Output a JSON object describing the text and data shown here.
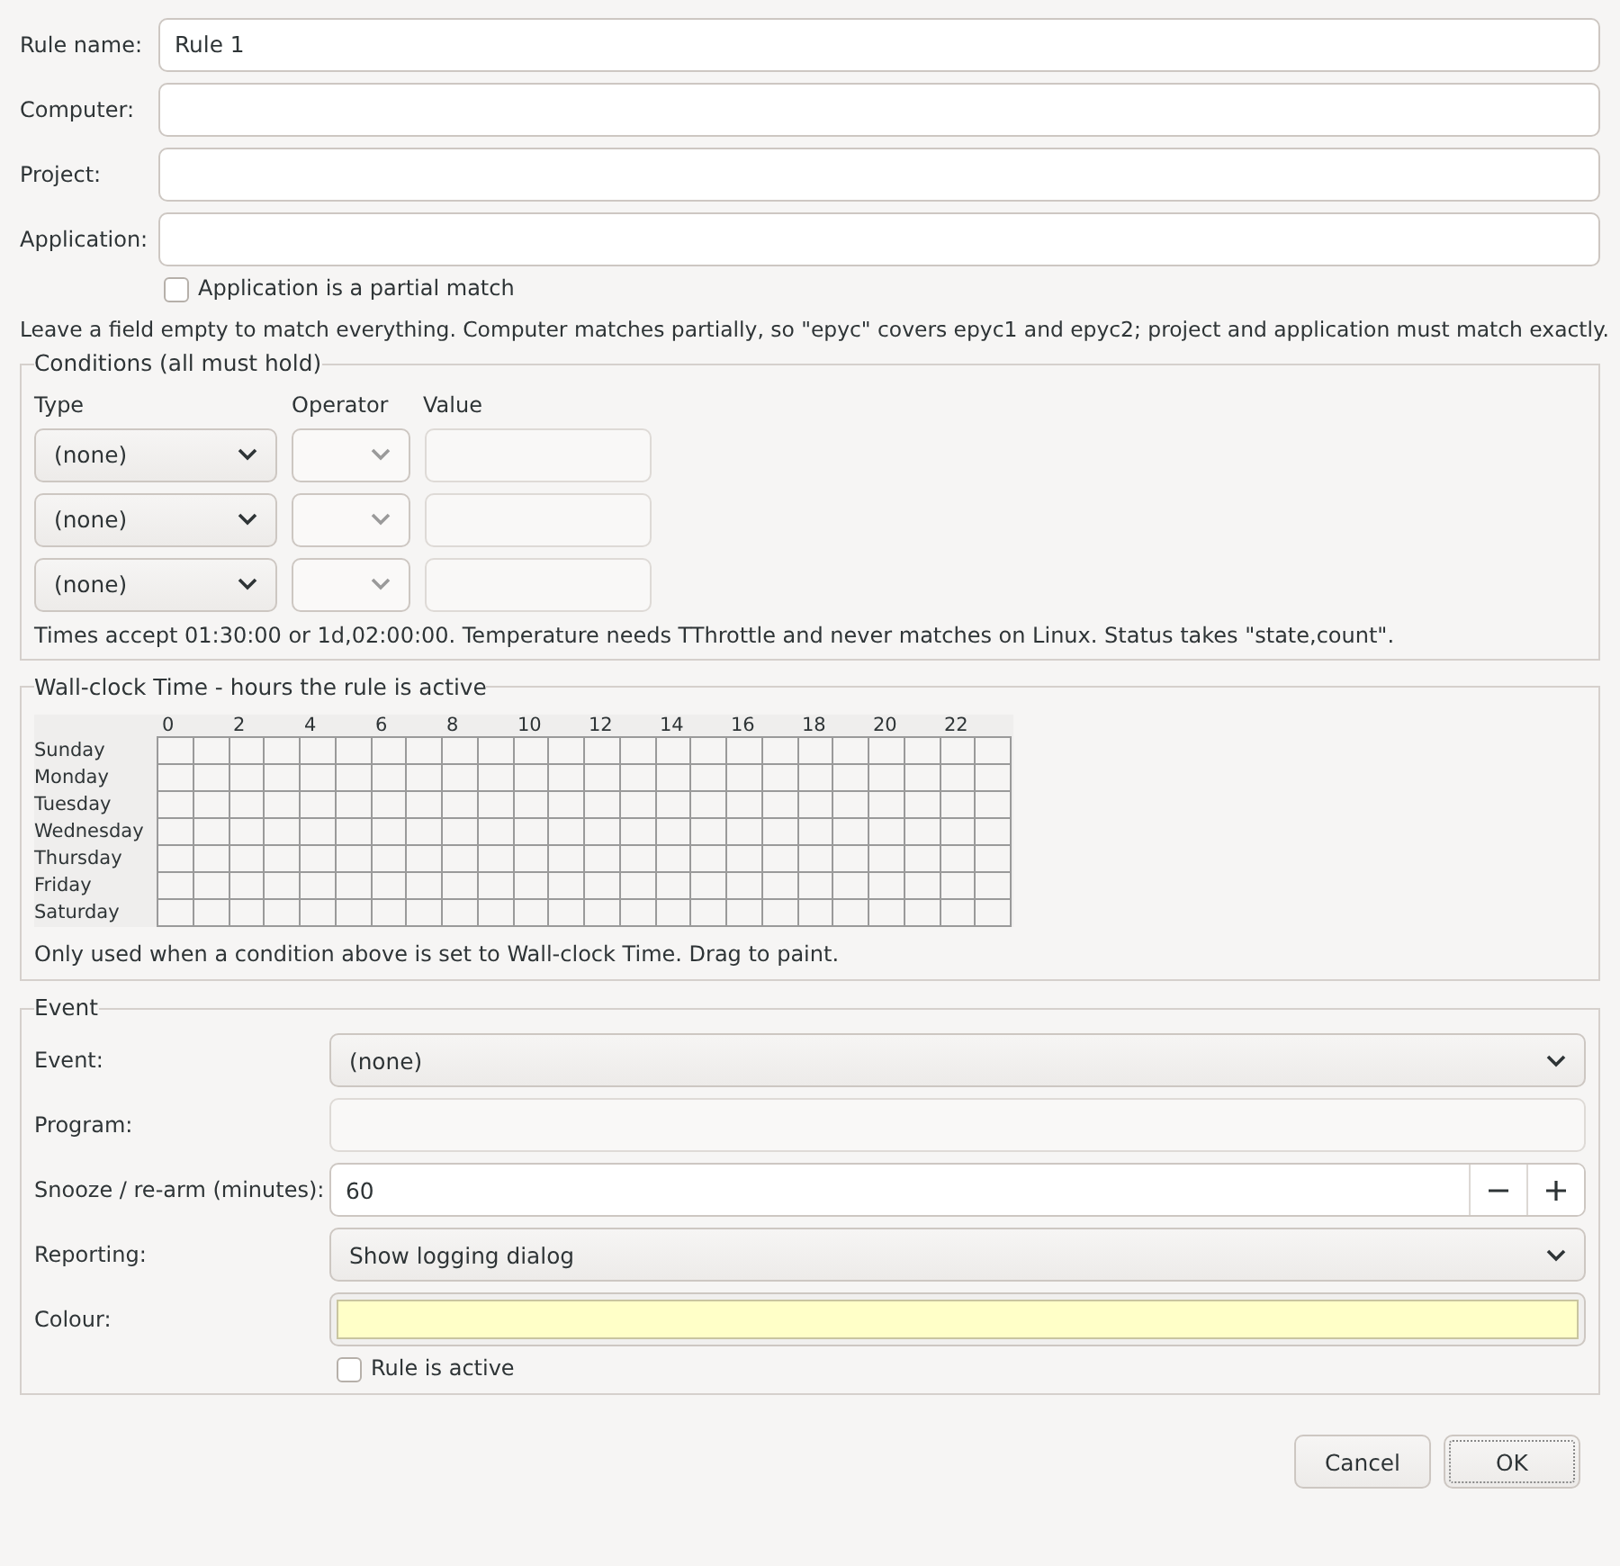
{
  "fields": [
    {
      "label": "Rule name:",
      "value": "Rule 1"
    },
    {
      "label": "Computer:"
    },
    {
      "label": "Project:"
    },
    {
      "label": "Application:"
    }
  ],
  "partial_match": {
    "label": "Application is a partial match",
    "checked": false
  },
  "hint": "Leave a field empty to match everything. Computer matches partially, so \"epyc\" covers epyc1 and epyc2; project and application must match exactly.",
  "conditions": {
    "title": "Conditions (all must hold)",
    "columns": [
      "Type",
      "Operator",
      "Value"
    ],
    "rows": [
      {
        "type": "(none)",
        "operator": {
          "disabled": true
        },
        "value": {
          "disabled": true
        }
      },
      {
        "type": "(none)",
        "operator": {
          "disabled": true
        },
        "value": {
          "disabled": true
        }
      },
      {
        "type": "(none)",
        "operator": {
          "disabled": true
        },
        "value": {
          "disabled": true
        }
      }
    ],
    "note": "Times accept 01:30:00 or 1d,02:00:00. Temperature needs TThrottle and never matches on Linux. Status takes \"state,count\"."
  },
  "wall_clock": {
    "title": "Wall-clock Time - hours the rule is active",
    "hour_labels": [
      "0",
      "2",
      "4",
      "6",
      "8",
      "10",
      "12",
      "14",
      "16",
      "18",
      "20",
      "22"
    ],
    "days": [
      {
        "day": "Sunday",
        "hours": [
          false,
          false,
          false,
          false,
          false,
          false,
          false,
          false,
          false,
          false,
          false,
          false,
          false,
          false,
          false,
          false,
          false,
          false,
          false,
          false,
          false,
          false,
          false,
          false
        ]
      },
      {
        "day": "Monday",
        "hours": [
          false,
          false,
          false,
          false,
          false,
          false,
          false,
          false,
          false,
          false,
          false,
          false,
          false,
          false,
          false,
          false,
          false,
          false,
          false,
          false,
          false,
          false,
          false,
          false
        ]
      },
      {
        "day": "Tuesday",
        "hours": [
          false,
          false,
          false,
          false,
          false,
          false,
          false,
          false,
          false,
          false,
          false,
          false,
          false,
          false,
          false,
          false,
          false,
          false,
          false,
          false,
          false,
          false,
          false,
          false
        ]
      },
      {
        "day": "Wednesday",
        "hours": [
          false,
          false,
          false,
          false,
          false,
          false,
          false,
          false,
          false,
          false,
          false,
          false,
          false,
          false,
          false,
          false,
          false,
          false,
          false,
          false,
          false,
          false,
          false,
          false
        ]
      },
      {
        "day": "Thursday",
        "hours": [
          false,
          false,
          false,
          false,
          false,
          false,
          false,
          false,
          false,
          false,
          false,
          false,
          false,
          false,
          false,
          false,
          false,
          false,
          false,
          false,
          false,
          false,
          false,
          false
        ]
      },
      {
        "day": "Friday",
        "hours": [
          false,
          false,
          false,
          false,
          false,
          false,
          false,
          false,
          false,
          false,
          false,
          false,
          false,
          false,
          false,
          false,
          false,
          false,
          false,
          false,
          false,
          false,
          false,
          false
        ]
      },
      {
        "day": "Saturday",
        "hours": [
          false,
          false,
          false,
          false,
          false,
          false,
          false,
          false,
          false,
          false,
          false,
          false,
          false,
          false,
          false,
          false,
          false,
          false,
          false,
          false,
          false,
          false,
          false,
          false
        ]
      }
    ],
    "note": "Only used when a condition above is set to Wall-clock Time. Drag to paint."
  },
  "event": {
    "title": "Event",
    "rows": [
      {
        "kind": "select",
        "label": "Event:",
        "value": "(none)"
      },
      {
        "kind": "text",
        "label": "Program:",
        "disabled": true
      },
      {
        "kind": "spin",
        "label": "Snooze / re-arm (minutes):",
        "value": "60"
      },
      {
        "kind": "select",
        "label": "Reporting:",
        "value": "Show logging dialog"
      },
      {
        "kind": "colour",
        "label": "Colour:",
        "color": "#ffffc8"
      }
    ],
    "active": {
      "label": "Rule is active",
      "checked": false
    }
  },
  "buttons": [
    {
      "label": "Cancel",
      "default": false
    },
    {
      "label": "OK",
      "default": true
    }
  ]
}
